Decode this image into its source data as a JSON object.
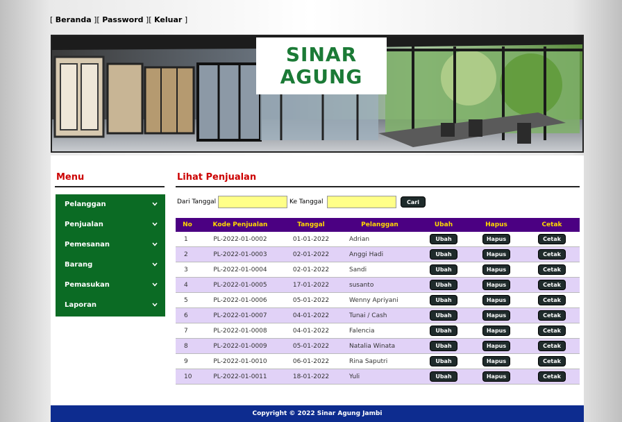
{
  "topnav": {
    "home": "Beranda",
    "password": "Password",
    "logout": "Keluar"
  },
  "banner": {
    "brand_line1": "SINAR",
    "brand_line2": "AGUNG"
  },
  "sidebar": {
    "title": "Menu",
    "items": [
      {
        "label": "Pelanggan"
      },
      {
        "label": "Penjualan"
      },
      {
        "label": "Pemesanan"
      },
      {
        "label": "Barang"
      },
      {
        "label": "Pemasukan"
      },
      {
        "label": "Laporan"
      }
    ]
  },
  "main": {
    "title": "Lihat Penjualan",
    "filter": {
      "from_label": "Dari Tanggal",
      "from_value": "",
      "to_label": "Ke Tanggal",
      "to_value": "",
      "search_label": "Cari"
    },
    "table": {
      "headers": [
        "No",
        "Kode Penjualan",
        "Tanggal",
        "Pelanggan",
        "Ubah",
        "Hapus",
        "Cetak"
      ],
      "rows": [
        {
          "no": "1",
          "kode": "PL-2022-01-0002",
          "tanggal": "01-01-2022",
          "pelanggan": "Adrian",
          "ubah": "Ubah",
          "hapus": "Hapus",
          "cetak": "Cetak"
        },
        {
          "no": "2",
          "kode": "PL-2022-01-0003",
          "tanggal": "02-01-2022",
          "pelanggan": "Anggi Hadi",
          "ubah": "Ubah",
          "hapus": "Hapus",
          "cetak": "Cetak"
        },
        {
          "no": "3",
          "kode": "PL-2022-01-0004",
          "tanggal": "02-01-2022",
          "pelanggan": "Sandi",
          "ubah": "Ubah",
          "hapus": "Hapus",
          "cetak": "Cetak"
        },
        {
          "no": "4",
          "kode": "PL-2022-01-0005",
          "tanggal": "17-01-2022",
          "pelanggan": "susanto",
          "ubah": "Ubah",
          "hapus": "Hapus",
          "cetak": "Cetak"
        },
        {
          "no": "5",
          "kode": "PL-2022-01-0006",
          "tanggal": "05-01-2022",
          "pelanggan": "Wenny Apriyani",
          "ubah": "Ubah",
          "hapus": "Hapus",
          "cetak": "Cetak"
        },
        {
          "no": "6",
          "kode": "PL-2022-01-0007",
          "tanggal": "04-01-2022",
          "pelanggan": "Tunai / Cash",
          "ubah": "Ubah",
          "hapus": "Hapus",
          "cetak": "Cetak"
        },
        {
          "no": "7",
          "kode": "PL-2022-01-0008",
          "tanggal": "04-01-2022",
          "pelanggan": "Falencia",
          "ubah": "Ubah",
          "hapus": "Hapus",
          "cetak": "Cetak"
        },
        {
          "no": "8",
          "kode": "PL-2022-01-0009",
          "tanggal": "05-01-2022",
          "pelanggan": "Natalia Winata",
          "ubah": "Ubah",
          "hapus": "Hapus",
          "cetak": "Cetak"
        },
        {
          "no": "9",
          "kode": "PL-2022-01-0010",
          "tanggal": "06-01-2022",
          "pelanggan": "Rina Saputri",
          "ubah": "Ubah",
          "hapus": "Hapus",
          "cetak": "Cetak"
        },
        {
          "no": "10",
          "kode": "PL-2022-01-0011",
          "tanggal": "18-01-2022",
          "pelanggan": "Yuli",
          "ubah": "Ubah",
          "hapus": "Hapus",
          "cetak": "Cetak"
        }
      ]
    }
  },
  "footer": {
    "text": "Copyright © 2022 Sinar Agung Jambi"
  },
  "colors": {
    "menu_bg": "#0b6b24",
    "table_header_bg": "#4b0082",
    "table_header_text": "#ffd800",
    "row_alt": "#e1d2f7",
    "title_red": "#cc0000",
    "footer_bg": "#0d2c8f",
    "input_bg": "#ffff88"
  }
}
